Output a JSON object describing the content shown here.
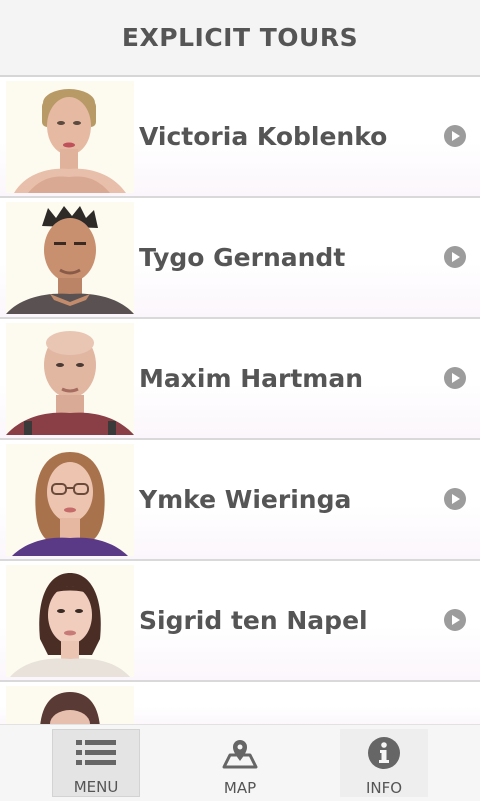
{
  "header": {
    "title": "EXPLICIT TOURS"
  },
  "people": [
    {
      "name": "Victoria Koblenko"
    },
    {
      "name": "Tygo Gernandt"
    },
    {
      "name": "Maxim Hartman"
    },
    {
      "name": "Ymke Wieringa"
    },
    {
      "name": "Sigrid ten Napel"
    }
  ],
  "tabs": {
    "menu": {
      "label": "MENU",
      "icon": "list-icon",
      "selected": true
    },
    "map": {
      "label": "MAP",
      "icon": "map-pin-icon"
    },
    "info": {
      "label": "INFO",
      "icon": "info-icon"
    }
  },
  "colors": {
    "text": "#555555",
    "header_bg": "#f4f4f4",
    "play_icon": "#9c9c9c",
    "selected_tab": "#e4e4e4"
  }
}
